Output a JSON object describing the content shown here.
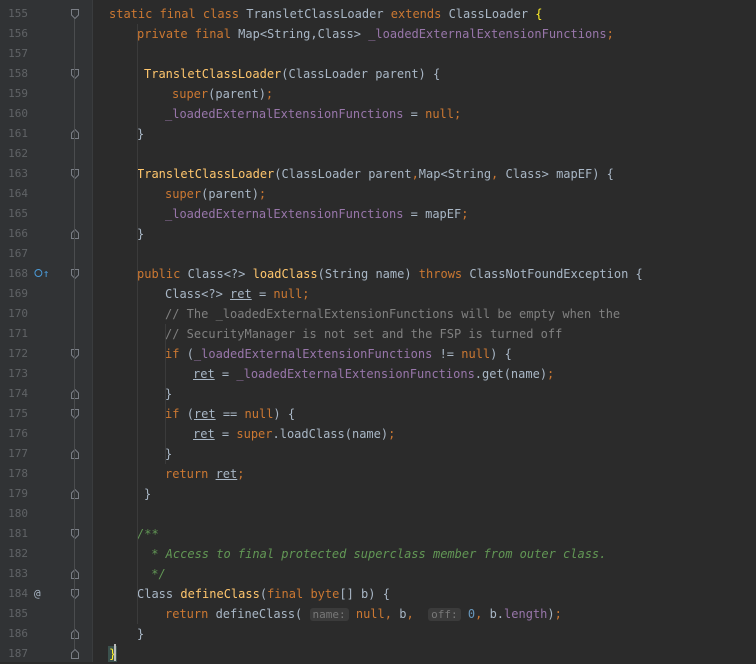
{
  "colors": {
    "background": "#2b2b2b",
    "gutter": "#313335",
    "line_number": "#606366",
    "keyword": "#cc7832",
    "method": "#ffc66d",
    "field": "#9876aa",
    "comment": "#808080",
    "doc_comment": "#629755",
    "number": "#6897bb",
    "text": "#a9b7c6"
  },
  "gutter_icons": {
    "override": "⭘↑",
    "annotation": "@"
  },
  "lines": [
    {
      "number": "155",
      "fold": "open",
      "tokens": [
        [
          "kw",
          "static final class "
        ],
        [
          "plain",
          "TransletClassLoader "
        ],
        [
          "kw",
          "extends "
        ],
        [
          "plain",
          "ClassLoader "
        ],
        [
          "brace-hl",
          "{"
        ]
      ]
    },
    {
      "number": "156",
      "tokens": [
        [
          "kw",
          "private final "
        ],
        [
          "plain",
          "Map<String,Class> "
        ],
        [
          "field",
          "_loadedExternalExtensionFunctions"
        ],
        [
          "kw",
          ";"
        ]
      ]
    },
    {
      "number": "157",
      "tokens": []
    },
    {
      "number": "158",
      "fold": "open",
      "tokens": [
        [
          "fn",
          "TransletClassLoader"
        ],
        [
          "plain",
          "(ClassLoader parent) {"
        ]
      ]
    },
    {
      "number": "159",
      "tokens": [
        [
          "kw",
          "super"
        ],
        [
          "plain",
          "(parent)"
        ],
        [
          "kw",
          ";"
        ]
      ]
    },
    {
      "number": "160",
      "tokens": [
        [
          "field",
          "_loadedExternalExtensionFunctions "
        ],
        [
          "plain",
          "= "
        ],
        [
          "kw",
          "null;"
        ]
      ]
    },
    {
      "number": "161",
      "fold": "close",
      "tokens": [
        [
          "plain",
          "}"
        ]
      ]
    },
    {
      "number": "162",
      "tokens": []
    },
    {
      "number": "163",
      "fold": "open",
      "tokens": [
        [
          "fn",
          "TransletClassLoader"
        ],
        [
          "plain",
          "(ClassLoader parent"
        ],
        [
          "kw",
          ","
        ],
        [
          "plain",
          "Map<String"
        ],
        [
          "kw",
          ", "
        ],
        [
          "plain",
          "Class> mapEF) {"
        ]
      ]
    },
    {
      "number": "164",
      "tokens": [
        [
          "kw",
          "super"
        ],
        [
          "plain",
          "(parent)"
        ],
        [
          "kw",
          ";"
        ]
      ]
    },
    {
      "number": "165",
      "tokens": [
        [
          "field",
          "_loadedExternalExtensionFunctions "
        ],
        [
          "plain",
          "= mapEF"
        ],
        [
          "kw",
          ";"
        ]
      ]
    },
    {
      "number": "166",
      "fold": "close",
      "tokens": [
        [
          "plain",
          "}"
        ]
      ]
    },
    {
      "number": "167",
      "tokens": []
    },
    {
      "number": "168",
      "icon": "override",
      "fold": "open",
      "tokens": [
        [
          "kw",
          "public "
        ],
        [
          "plain",
          "Class<?> "
        ],
        [
          "fn",
          "loadClass"
        ],
        [
          "plain",
          "(String name) "
        ],
        [
          "kw",
          "throws "
        ],
        [
          "plain",
          "ClassNotFoundException {"
        ]
      ]
    },
    {
      "number": "169",
      "tokens": [
        [
          "plain",
          "Class<?> "
        ],
        [
          "under",
          "ret"
        ],
        [
          "plain",
          " = "
        ],
        [
          "kw",
          "null;"
        ]
      ]
    },
    {
      "number": "170",
      "tokens": [
        [
          "cmt",
          "// The _loadedExternalExtensionFunctions will be empty when the"
        ]
      ]
    },
    {
      "number": "171",
      "tokens": [
        [
          "cmt",
          "// SecurityManager is not set and the FSP is turned off"
        ]
      ]
    },
    {
      "number": "172",
      "fold": "open",
      "tokens": [
        [
          "kw",
          "if "
        ],
        [
          "plain",
          "("
        ],
        [
          "field",
          "_loadedExternalExtensionFunctions "
        ],
        [
          "plain",
          "!= "
        ],
        [
          "kw",
          "null"
        ],
        [
          "plain",
          ") {"
        ]
      ]
    },
    {
      "number": "173",
      "tokens": [
        [
          "under",
          "ret"
        ],
        [
          "plain",
          " = "
        ],
        [
          "field",
          "_loadedExternalExtensionFunctions"
        ],
        [
          "plain",
          ".get(name)"
        ],
        [
          "kw",
          ";"
        ]
      ]
    },
    {
      "number": "174",
      "fold": "close",
      "tokens": [
        [
          "plain",
          "}"
        ]
      ]
    },
    {
      "number": "175",
      "fold": "open",
      "tokens": [
        [
          "kw",
          "if "
        ],
        [
          "plain",
          "("
        ],
        [
          "under",
          "ret"
        ],
        [
          "plain",
          " == "
        ],
        [
          "kw",
          "null"
        ],
        [
          "plain",
          ") {"
        ]
      ]
    },
    {
      "number": "176",
      "tokens": [
        [
          "under",
          "ret"
        ],
        [
          "plain",
          " = "
        ],
        [
          "kw",
          "super"
        ],
        [
          "plain",
          ".loadClass(name)"
        ],
        [
          "kw",
          ";"
        ]
      ]
    },
    {
      "number": "177",
      "fold": "close",
      "tokens": [
        [
          "plain",
          "}"
        ]
      ]
    },
    {
      "number": "178",
      "tokens": [
        [
          "kw",
          "return "
        ],
        [
          "under",
          "ret"
        ],
        [
          "kw",
          ";"
        ]
      ]
    },
    {
      "number": "179",
      "fold": "close",
      "tokens": [
        [
          "plain",
          "}"
        ]
      ]
    },
    {
      "number": "180",
      "tokens": []
    },
    {
      "number": "181",
      "fold": "open",
      "tokens": [
        [
          "doc",
          "/**"
        ]
      ]
    },
    {
      "number": "182",
      "tokens": [
        [
          "doc",
          " * Access to final protected superclass member from outer class."
        ]
      ]
    },
    {
      "number": "183",
      "fold": "close",
      "tokens": [
        [
          "doc",
          " */"
        ]
      ]
    },
    {
      "number": "184",
      "icon": "annotation",
      "fold": "open",
      "tokens": [
        [
          "plain",
          "Class "
        ],
        [
          "fn",
          "defineClass"
        ],
        [
          "plain",
          "("
        ],
        [
          "kw",
          "final "
        ],
        [
          "kw",
          "byte"
        ],
        [
          "plain",
          "[] b) {"
        ]
      ]
    },
    {
      "number": "185",
      "tokens": [
        [
          "kw",
          "return "
        ],
        [
          "plain",
          "defineClass( "
        ],
        [
          "hint",
          "name:"
        ],
        [
          "plain",
          " "
        ],
        [
          "kw",
          "null"
        ],
        [
          "kw",
          ", "
        ],
        [
          "plain",
          "b"
        ],
        [
          "kw",
          ", "
        ],
        [
          "plain",
          " "
        ],
        [
          "hint",
          "off:"
        ],
        [
          "plain",
          " "
        ],
        [
          "num",
          "0"
        ],
        [
          "kw",
          ", "
        ],
        [
          "plain",
          "b."
        ],
        [
          "field",
          "length"
        ],
        [
          "plain",
          ")"
        ],
        [
          "kw",
          ";"
        ]
      ]
    },
    {
      "number": "186",
      "fold": "close",
      "tokens": [
        [
          "plain",
          "}"
        ]
      ]
    },
    {
      "number": "187",
      "fold": "close",
      "tokens": [
        [
          "brace-match",
          "}"
        ]
      ]
    }
  ]
}
